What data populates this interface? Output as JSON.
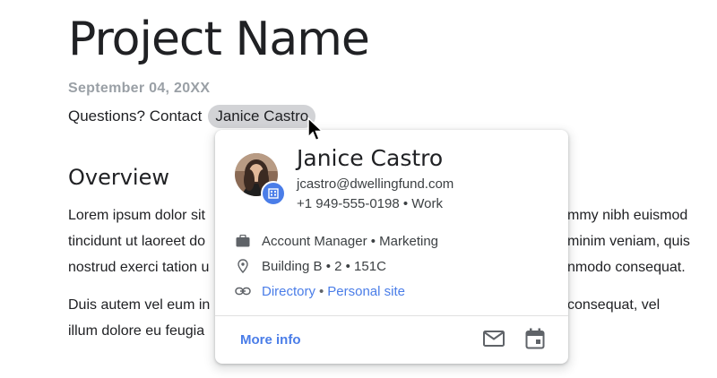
{
  "document": {
    "title": "Project Name",
    "date": "September 04, 20XX",
    "contact_prefix": "Questions? Contact",
    "contact_chip": "Janice Castro",
    "overview_heading": "Overview",
    "paragraph1": {
      "left": [
        "Lorem ipsum dolor sit",
        "tincidunt ut laoreet do",
        "nostrud exerci tation u"
      ],
      "right": [
        "mmy nibh euismod",
        "minim veniam, quis",
        "nmodo consequat."
      ]
    },
    "paragraph2": {
      "left": [
        "Duis autem vel eum in",
        "illum dolore eu feugia"
      ],
      "right": [
        "consequat, vel",
        ""
      ]
    }
  },
  "card": {
    "name": "Janice Castro",
    "email": "jcastro@dwellingfund.com",
    "phone": "+1 949-555-0198 • Work",
    "role": "Account Manager • Marketing",
    "location": "Building B • 2 • 151C",
    "links": {
      "directory": "Directory",
      "separator": "•",
      "personal_site": "Personal site"
    },
    "more_info": "More info"
  },
  "colors": {
    "accent": "#4a7de8",
    "chip_bg": "#d2d3d6",
    "muted_text": "#9aa0a6"
  },
  "icons": [
    "briefcase-icon",
    "location-pin-icon",
    "link-icon",
    "mail-icon",
    "calendar-icon",
    "building-badge-icon",
    "mouse-cursor-icon"
  ]
}
